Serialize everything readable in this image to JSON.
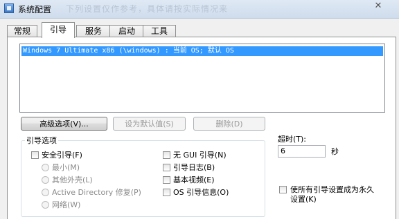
{
  "window": {
    "title": "系统配置",
    "ghost_text": "下列设置仅作参考，具体请按实际情况来",
    "close_glyph": "✕"
  },
  "tabs": [
    {
      "label": "常规"
    },
    {
      "label": "引导"
    },
    {
      "label": "服务"
    },
    {
      "label": "启动"
    },
    {
      "label": "工具"
    }
  ],
  "os_list": {
    "selected_entry": "Windows 7 Ultimate x86 (\\windows) : 当前 OS; 默认 OS"
  },
  "buttons": {
    "advanced": "高级选项(V)...",
    "set_default": "设为默认值(S)",
    "delete": "删除(D)"
  },
  "boot_options": {
    "legend": "引导选项",
    "safe_boot": "安全引导(F)",
    "minimal": "最小(M)",
    "alternate_shell": "其他外壳(L)",
    "active_directory_repair": "Active Directory 修复(P)",
    "network": "网络(W)",
    "no_gui_boot": "无 GUI 引导(N)",
    "boot_log": "引导日志(B)",
    "base_video": "基本视频(E)",
    "os_boot_info": "OS 引导信息(O)"
  },
  "timeout": {
    "label": "超时(T):",
    "value": "6",
    "unit": "秒"
  },
  "permanent": {
    "label_line1": "使所有引导设置成为永久",
    "label_line2": "设置(K)"
  }
}
